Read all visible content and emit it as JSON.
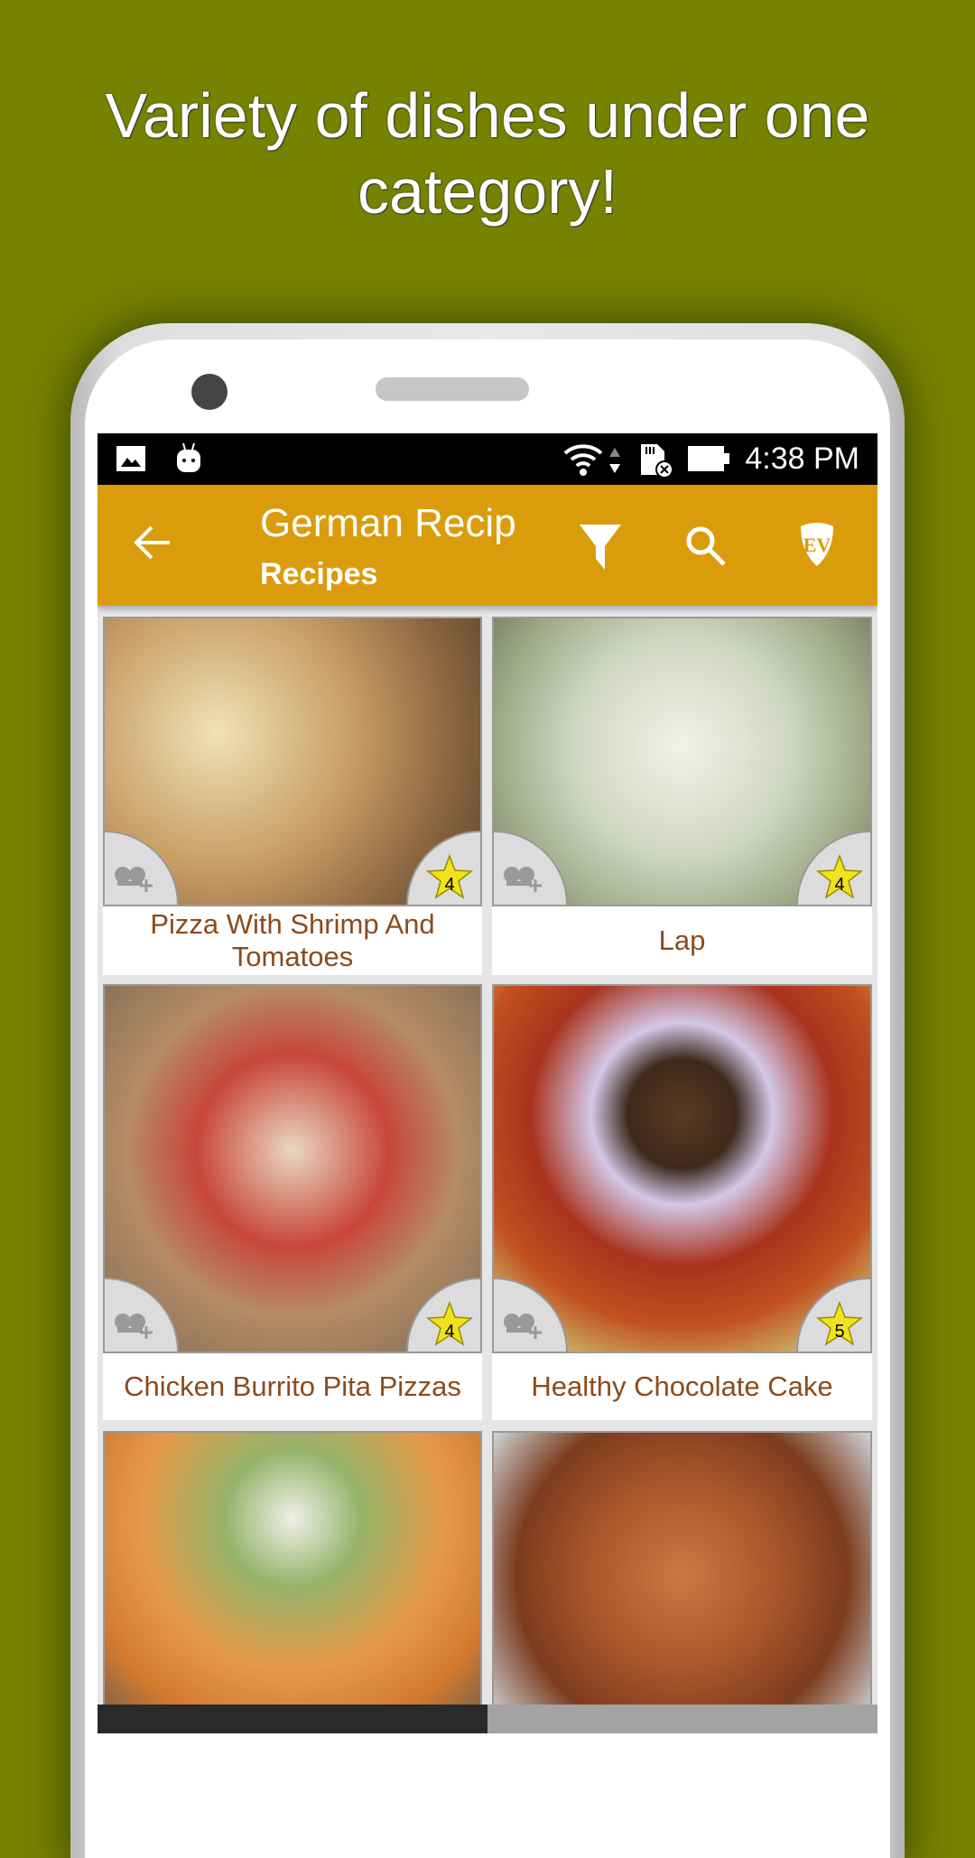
{
  "headline": {
    "line1": "Variety of dishes under one",
    "line2": "category!"
  },
  "status_bar": {
    "time": "4:38 PM",
    "icons": [
      "image-icon",
      "android-icon",
      "wifi-icon",
      "data-arrows-icon",
      "sd-card-error-icon",
      "battery-icon"
    ]
  },
  "app_bar": {
    "title": "German Recip",
    "subtitle": "Recipes",
    "actions": [
      "back-arrow-icon",
      "filter-icon",
      "search-icon",
      "ev-badge-icon"
    ]
  },
  "colors": {
    "background": "#778200",
    "app_bar": "#db9c0c",
    "caption_text": "#8b4b1d",
    "star": "#f2e11e"
  },
  "recipes": [
    {
      "name": "Pizza With Shrimp And Tomatoes",
      "rating": "4"
    },
    {
      "name": "Lap",
      "rating": "4"
    },
    {
      "name": "Chicken Burrito Pita Pizzas",
      "rating": "4"
    },
    {
      "name": "Healthy Chocolate Cake",
      "rating": "5"
    },
    {
      "name": "",
      "rating": ""
    },
    {
      "name": "",
      "rating": ""
    }
  ]
}
